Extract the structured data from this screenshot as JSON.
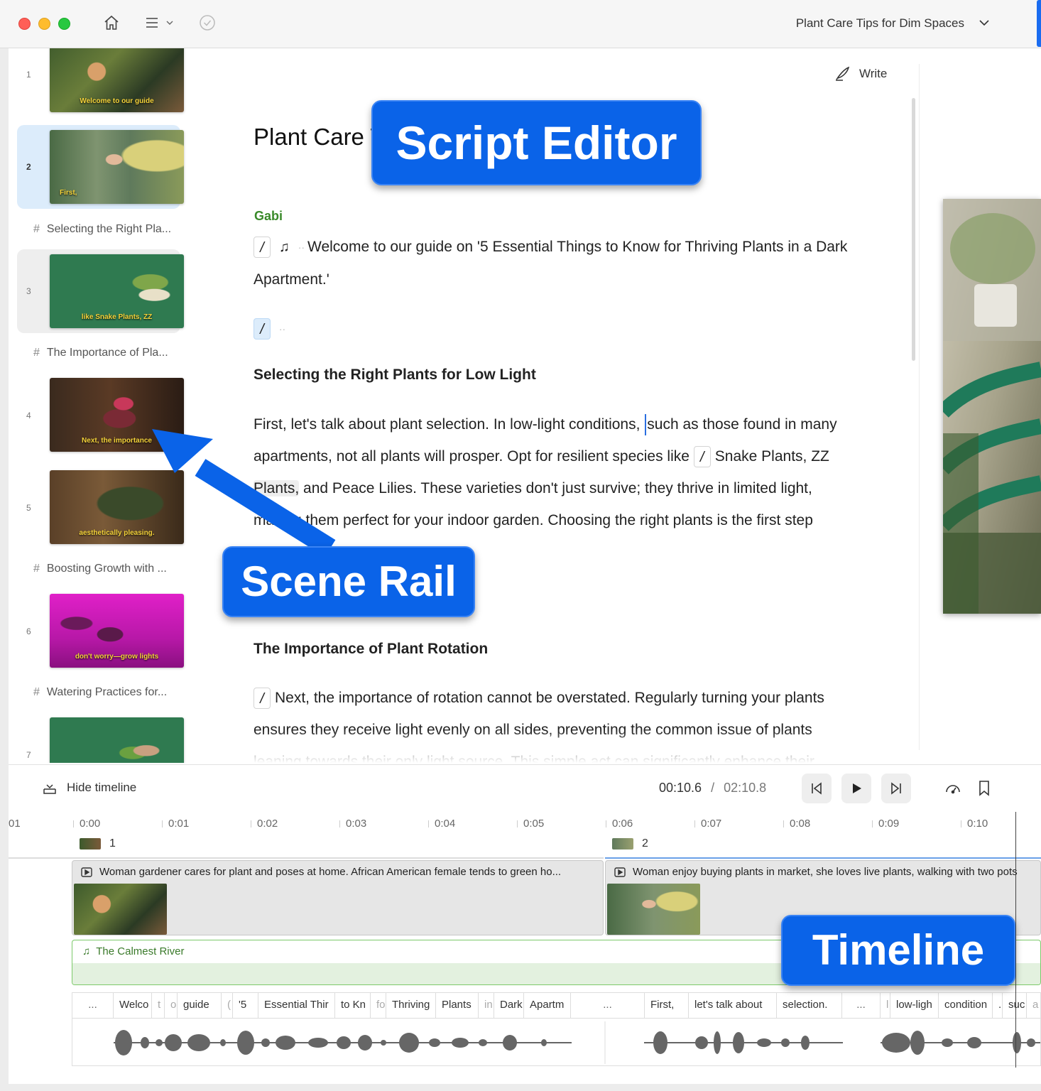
{
  "window": {
    "title": "Plant Care Tips for Dim Spaces",
    "accent": "#1a6cf0"
  },
  "toolbar": {
    "icons": [
      "home-icon",
      "menu-icon",
      "chevron-down-icon",
      "check-circle-icon"
    ],
    "write_label": "Write"
  },
  "scene_rail": {
    "scenes": [
      {
        "number": "1",
        "caption": "Welcome to our guide",
        "state": "normal"
      },
      {
        "number": "2",
        "caption": "First,",
        "state": "selected"
      },
      {
        "number": "3",
        "caption": "like Snake Plants, ZZ",
        "state": "hover"
      },
      {
        "number": "4",
        "caption": "Next, the importance",
        "state": "normal"
      },
      {
        "number": "5",
        "caption": "aesthetically pleasing.",
        "state": "normal"
      },
      {
        "number": "6",
        "caption": "don't worry—grow lights",
        "state": "normal"
      },
      {
        "number": "7",
        "caption": "",
        "state": "normal"
      }
    ],
    "sections": [
      "Selecting the Right Pla...",
      "The Importance of Pla...",
      "Boosting Growth with ...",
      "Watering Practices for..."
    ]
  },
  "editor": {
    "doc_title": "Plant Care Tips for Dim Spaces",
    "speaker": "Gabi",
    "intro_text": "Welcome to our guide on '5 Essential Things to Know for Thriving Plants in a Dark Apartment.'",
    "heading_1": "Selecting the Right Plants for Low Light",
    "para_1_before_caret": "First, let's talk about plant selection. In low-light conditions, ",
    "para_1_after_caret": "such as those found in many apartments, not all plants will prosper. Opt for resilient species like ",
    "para_1_snake": "Snake Plants, ZZ ",
    "para_1_plants": "Plants,",
    "para_1_rest": " and Peace Lilies. These varieties don't just survive; they thrive in limited light, making them perfect for your indoor garden. Choosing the right plants is the first step",
    "heading_2": "The Importance of Plant Rotation",
    "para_2": "Next, the importance of rotation cannot be overstated. Regularly turning your plants ensures they receive light evenly on all sides, preventing the common issue of plants leaning towards their only light source. This simple act can significantly enhance their"
  },
  "timeline": {
    "hide_label": "Hide timeline",
    "current_time": "00:10.6",
    "separator": "/",
    "total_time": "02:10.8",
    "ruler_ticks": [
      "01",
      "0:00",
      "0:01",
      "0:02",
      "0:03",
      "0:04",
      "0:05",
      "0:06",
      "0:07",
      "0:08",
      "0:09",
      "0:10"
    ],
    "scene_markers": [
      "1",
      "2"
    ],
    "clips": [
      {
        "title": "Woman gardener cares for plant and poses at home. African American female tends to green ho..."
      },
      {
        "title": "Woman enjoy buying plants in market, she loves live plants, walking with two pots"
      }
    ],
    "music_title": "The Calmest River",
    "words": [
      "...",
      "Welco",
      "t",
      "o",
      "guide",
      "(",
      "'5",
      "Essential Thir",
      "to Kn",
      "fo",
      "Thriving",
      "Plants",
      "in",
      "Dark",
      "Apartm",
      "...",
      "First,",
      "let's talk about",
      "selection.",
      "...",
      "l",
      "low-ligh",
      "condition",
      ".",
      "suc",
      "a"
    ]
  },
  "annotations": {
    "script_editor": "Script Editor",
    "scene_rail": "Scene Rail",
    "timeline": "Timeline"
  }
}
